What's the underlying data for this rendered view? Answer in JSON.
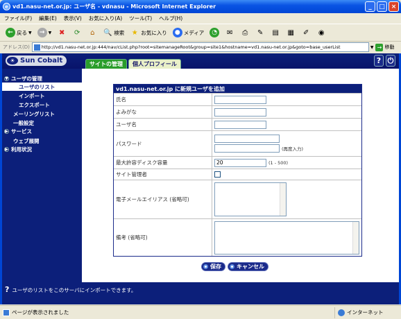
{
  "window": {
    "title": "vd1.nasu-net.or.jp: ユーザ名 - vdnasu - Microsoft Internet Explorer"
  },
  "menu": [
    "ファイル(F)",
    "編集(E)",
    "表示(V)",
    "お気に入り(A)",
    "ツール(T)",
    "ヘルプ(H)"
  ],
  "toolbar": {
    "back_label": "戻る",
    "search_label": "検索",
    "favorites_label": "お気に入り",
    "media_label": "メディア"
  },
  "address": {
    "label": "アドレス(D)",
    "url": "http://vd1.nasu-net.or.jp:444/nav/cList.php?root=sitemanageRoot&group=site1&hostname=vd1.nasu-net.or.jp&goto=base_userList",
    "go_label": "移動"
  },
  "app": {
    "logo": "Sun Cobalt",
    "tabs": [
      "サイトの管理",
      "個人プロフィール"
    ]
  },
  "sidebar": {
    "items": [
      {
        "label": "ユーザの管理",
        "kind": "head"
      },
      {
        "label": "ユーザのリスト",
        "kind": "sub-selected"
      },
      {
        "label": "インポート",
        "kind": "sub"
      },
      {
        "label": "エクスポート",
        "kind": "sub"
      },
      {
        "label": "メーリングリスト",
        "kind": "plain"
      },
      {
        "label": "一般設定",
        "kind": "plain"
      },
      {
        "label": "サービス",
        "kind": "head"
      },
      {
        "label": "ウェブ展開",
        "kind": "plain"
      },
      {
        "label": "利用状況",
        "kind": "head"
      }
    ]
  },
  "form": {
    "title": "vd1.nasu-net.or.jp に新規ユーザを追加",
    "fields": {
      "fullname_label": "氏名",
      "furigana_label": "よみがな",
      "username_label": "ユーザ名",
      "password_label": "パスワード",
      "password_confirm_note": "(再度入力)",
      "quota_label": "最大許容ディスク容量",
      "quota_value": "20",
      "quota_range": "(1 - 500)",
      "siteadmin_label": "サイト管理者",
      "alias_label": "電子メールエイリアス (省略可)",
      "notes_label": "備考 (省略可)"
    },
    "save_label": "保存",
    "cancel_label": "キャンセル"
  },
  "help": {
    "text": "ユーザのリストをこのサーバにインポートできます。"
  },
  "status": {
    "left": "ページが表示されました",
    "zone": "インターネット"
  }
}
